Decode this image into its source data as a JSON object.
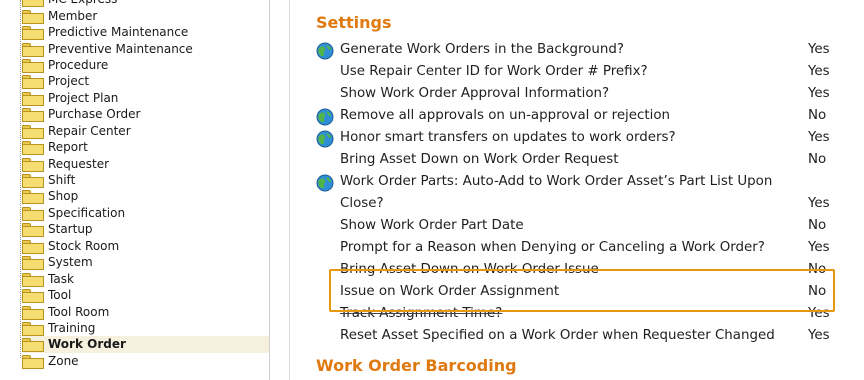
{
  "tree": {
    "items": [
      {
        "label": "MC Express",
        "selected": false
      },
      {
        "label": "Member",
        "selected": false
      },
      {
        "label": "Predictive Maintenance",
        "selected": false
      },
      {
        "label": "Preventive Maintenance",
        "selected": false
      },
      {
        "label": "Procedure",
        "selected": false
      },
      {
        "label": "Project",
        "selected": false
      },
      {
        "label": "Project Plan",
        "selected": false
      },
      {
        "label": "Purchase Order",
        "selected": false
      },
      {
        "label": "Repair Center",
        "selected": false
      },
      {
        "label": "Report",
        "selected": false
      },
      {
        "label": "Requester",
        "selected": false
      },
      {
        "label": "Shift",
        "selected": false
      },
      {
        "label": "Shop",
        "selected": false
      },
      {
        "label": "Specification",
        "selected": false
      },
      {
        "label": "Startup",
        "selected": false
      },
      {
        "label": "Stock Room",
        "selected": false
      },
      {
        "label": "System",
        "selected": false
      },
      {
        "label": "Task",
        "selected": false
      },
      {
        "label": "Tool",
        "selected": false
      },
      {
        "label": "Tool Room",
        "selected": false
      },
      {
        "label": "Training",
        "selected": false
      },
      {
        "label": "Work Order",
        "selected": true
      },
      {
        "label": "Zone",
        "selected": false
      }
    ]
  },
  "settings": {
    "title": "Settings",
    "rows": [
      {
        "label": "Generate Work Orders in the Background?",
        "value": "Yes",
        "globe": true,
        "struck": false
      },
      {
        "label": "Use Repair Center ID for Work Order # Prefix?",
        "value": "Yes",
        "globe": false,
        "struck": false
      },
      {
        "label": "Show Work Order Approval Information?",
        "value": "Yes",
        "globe": false,
        "struck": false
      },
      {
        "label": "Remove all approvals on un-approval or rejection",
        "value": "No",
        "globe": true,
        "struck": false
      },
      {
        "label": "Honor smart transfers on updates to work orders?",
        "value": "Yes",
        "globe": true,
        "struck": false
      },
      {
        "label": "Bring Asset Down on Work Order Request",
        "value": "No",
        "globe": false,
        "struck": false
      },
      {
        "label": "Work Order Parts: Auto-Add to Work Order Asset’s Part List Upon",
        "value": "",
        "globe": true,
        "struck": false
      },
      {
        "label": "Close?",
        "value": "Yes",
        "globe": false,
        "struck": false
      },
      {
        "label": "Show Work Order Part Date",
        "value": "No",
        "globe": false,
        "struck": false
      },
      {
        "label": "Prompt for a Reason when Denying or Canceling a Work Order?",
        "value": "Yes",
        "globe": false,
        "struck": false
      },
      {
        "label": "Bring Asset Down on Work Order Issue",
        "value": "No",
        "globe": false,
        "struck": true
      },
      {
        "label": "Issue on Work Order Assignment",
        "value": "No",
        "globe": false,
        "struck": false
      },
      {
        "label": "Track Assignment Time?",
        "value": "Yes",
        "globe": false,
        "struck": true
      },
      {
        "label": "Reset Asset Specified on a Work Order when Requester Changed",
        "value": "Yes",
        "globe": false,
        "struck": false
      }
    ]
  },
  "barcoding": {
    "title": "Work Order Barcoding"
  },
  "colors": {
    "section_title": "#e07a10",
    "highlight_border": "#e8980f",
    "selected_bg": "#f6f0df"
  }
}
